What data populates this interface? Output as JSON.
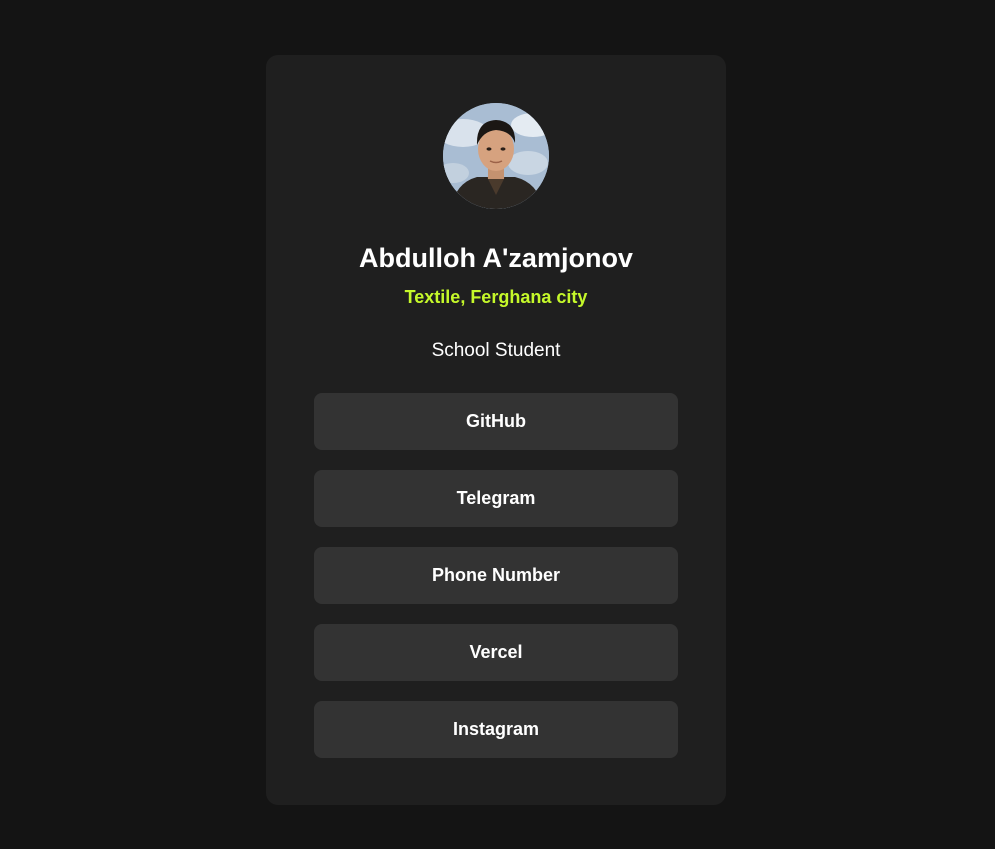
{
  "profile": {
    "name": "Abdulloh A'zamjonov",
    "location": "Textile, Ferghana city",
    "role": "School Student",
    "accent_color": "#c5f82a"
  },
  "links": [
    {
      "label": "GitHub"
    },
    {
      "label": "Telegram"
    },
    {
      "label": "Phone Number"
    },
    {
      "label": "Vercel"
    },
    {
      "label": "Instagram"
    }
  ]
}
